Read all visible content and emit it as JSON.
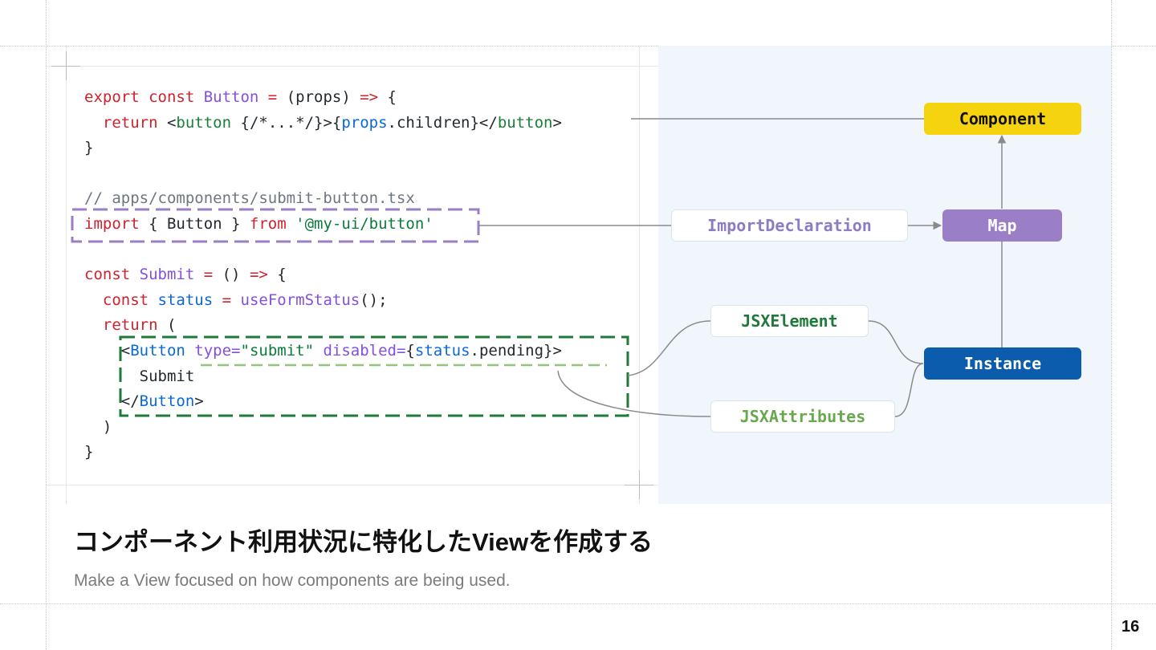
{
  "code": {
    "lines": [
      [
        {
          "t": "export const ",
          "c": "k"
        },
        {
          "t": "Button",
          "c": "p"
        },
        {
          "t": " = ",
          "c": "k"
        },
        {
          "t": "(props) ",
          "c": "t"
        },
        {
          "t": "=>",
          "c": "k"
        },
        {
          "t": " {",
          "c": "t"
        }
      ],
      [
        {
          "t": "  ",
          "c": "t"
        },
        {
          "t": "return",
          "c": "k"
        },
        {
          "t": " <",
          "c": "t"
        },
        {
          "t": "button",
          "c": "g"
        },
        {
          "t": " {/*...*/}>{",
          "c": "t"
        },
        {
          "t": "props",
          "c": "b"
        },
        {
          "t": ".children}</",
          "c": "t"
        },
        {
          "t": "button",
          "c": "g"
        },
        {
          "t": ">",
          "c": "t"
        }
      ],
      [
        {
          "t": "}",
          "c": "t"
        }
      ],
      [
        {
          "t": "",
          "c": "t"
        }
      ],
      [
        {
          "t": "// apps/components/submit-button.tsx",
          "c": "c"
        }
      ],
      [
        {
          "t": "import",
          "c": "k"
        },
        {
          "t": " { Button } ",
          "c": "t"
        },
        {
          "t": "from",
          "c": "k"
        },
        {
          "t": " '@my-ui/button'",
          "c": "s"
        }
      ],
      [
        {
          "t": "",
          "c": "t"
        }
      ],
      [
        {
          "t": "const ",
          "c": "k"
        },
        {
          "t": "Submit",
          "c": "p"
        },
        {
          "t": " = ",
          "c": "k"
        },
        {
          "t": "() ",
          "c": "t"
        },
        {
          "t": "=>",
          "c": "k"
        },
        {
          "t": " {",
          "c": "t"
        }
      ],
      [
        {
          "t": "  ",
          "c": "t"
        },
        {
          "t": "const ",
          "c": "k"
        },
        {
          "t": "status",
          "c": "b"
        },
        {
          "t": " = ",
          "c": "k"
        },
        {
          "t": "useFormStatus",
          "c": "p"
        },
        {
          "t": "();",
          "c": "t"
        }
      ],
      [
        {
          "t": "  ",
          "c": "t"
        },
        {
          "t": "return",
          "c": "k"
        },
        {
          "t": " (",
          "c": "t"
        }
      ],
      [
        {
          "t": "    <",
          "c": "t"
        },
        {
          "t": "Button",
          "c": "b"
        },
        {
          "t": " ",
          "c": "t"
        },
        {
          "t": "type=",
          "c": "p"
        },
        {
          "t": "\"submit\"",
          "c": "s"
        },
        {
          "t": " ",
          "c": "t"
        },
        {
          "t": "disabled=",
          "c": "p"
        },
        {
          "t": "{",
          "c": "t"
        },
        {
          "t": "status",
          "c": "b"
        },
        {
          "t": ".pending}>",
          "c": "t"
        }
      ],
      [
        {
          "t": "      Submit",
          "c": "t"
        }
      ],
      [
        {
          "t": "    </",
          "c": "t"
        },
        {
          "t": "Button",
          "c": "b"
        },
        {
          "t": ">",
          "c": "t"
        }
      ],
      [
        {
          "t": "  )",
          "c": "t"
        }
      ],
      [
        {
          "t": "}",
          "c": "t"
        }
      ]
    ]
  },
  "nodes": {
    "component": {
      "label": "Component",
      "bg": "#f5d30f",
      "fg": "#111111"
    },
    "map": {
      "label": "Map",
      "bg": "#9b7fc6",
      "fg": "#ffffff"
    },
    "instance": {
      "label": "Instance",
      "bg": "#0b5cad",
      "fg": "#ffffff"
    },
    "import_decl": {
      "label": "ImportDeclaration",
      "fg": "#8e7cc3"
    },
    "jsx_element": {
      "label": "JSXElement",
      "fg": "#1f7a3a"
    },
    "jsx_attributes": {
      "label": "JSXAttributes",
      "fg": "#6aa84f"
    }
  },
  "colors": {
    "highlight_purple": "#9b7fc6",
    "highlight_green": "#1f7a3a",
    "highlight_light_green": "#93c47d",
    "connector": "#8a8a8a"
  },
  "caption": {
    "title": "コンポーネント利用状況に特化したViewを作成する",
    "subtitle": "Make a View focused on how components are being used."
  },
  "page_number": "16"
}
